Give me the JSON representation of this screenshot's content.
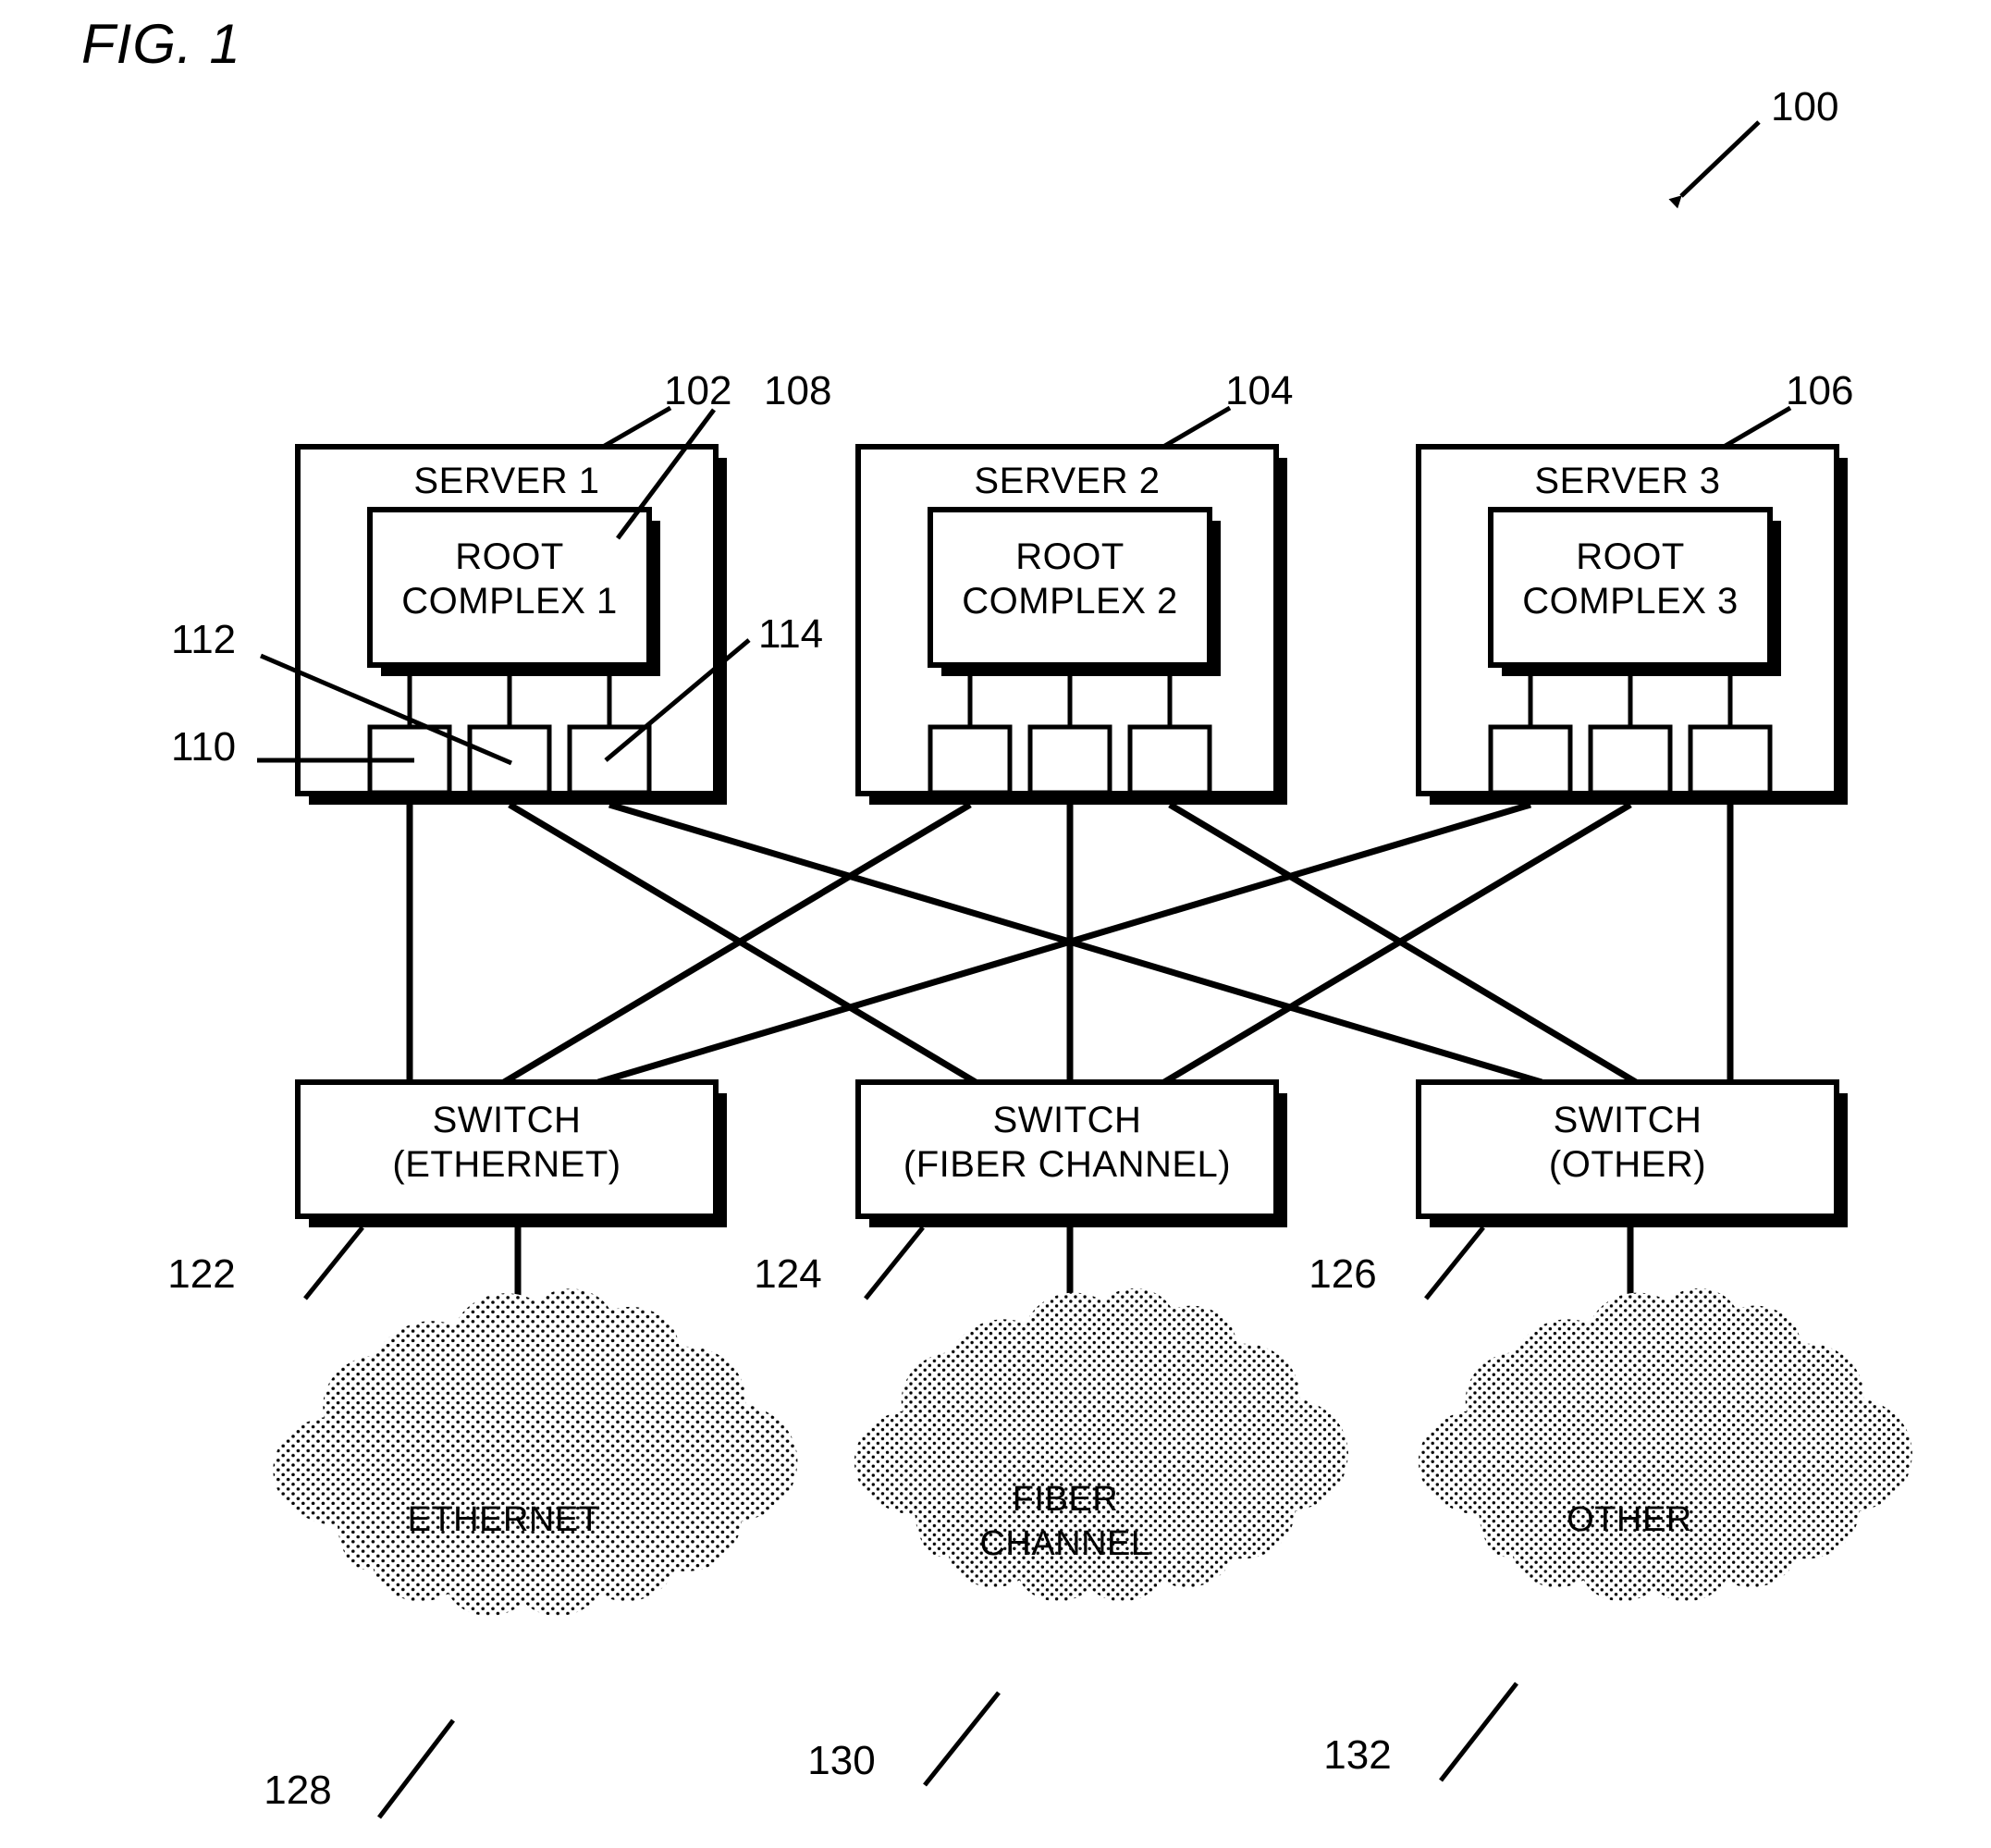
{
  "figure": {
    "title": "FIG. 1",
    "system_ref": "100"
  },
  "servers": [
    {
      "name": "SERVER 1",
      "ref": "102",
      "root_complex": {
        "line1": "ROOT",
        "line2": "COMPLEX 1",
        "ref": "108"
      },
      "ports": [
        {
          "ref": "110"
        },
        {
          "ref": "112"
        },
        {
          "ref": "114"
        }
      ]
    },
    {
      "name": "SERVER 2",
      "ref": "104",
      "root_complex": {
        "line1": "ROOT",
        "line2": "COMPLEX 2",
        "ref": ""
      },
      "ports": [
        {
          "ref": ""
        },
        {
          "ref": ""
        },
        {
          "ref": ""
        }
      ]
    },
    {
      "name": "SERVER 3",
      "ref": "106",
      "root_complex": {
        "line1": "ROOT",
        "line2": "COMPLEX 3",
        "ref": ""
      },
      "ports": [
        {
          "ref": ""
        },
        {
          "ref": ""
        },
        {
          "ref": ""
        }
      ]
    }
  ],
  "switches": [
    {
      "line1": "SWITCH",
      "line2": "(ETHERNET)",
      "ref": "122"
    },
    {
      "line1": "SWITCH",
      "line2": "(FIBER CHANNEL)",
      "ref": "124"
    },
    {
      "line1": "SWITCH",
      "line2": "(OTHER)",
      "ref": "126"
    }
  ],
  "networks": [
    {
      "line1": "ETHERNET",
      "line2": "",
      "ref": "128"
    },
    {
      "line1": "FIBER",
      "line2": "CHANNEL",
      "ref": "130"
    },
    {
      "line1": "OTHER",
      "line2": "",
      "ref": "132"
    }
  ],
  "colors": {
    "ink": "#000000",
    "paper": "#ffffff",
    "cloud_fill": "#000000"
  }
}
